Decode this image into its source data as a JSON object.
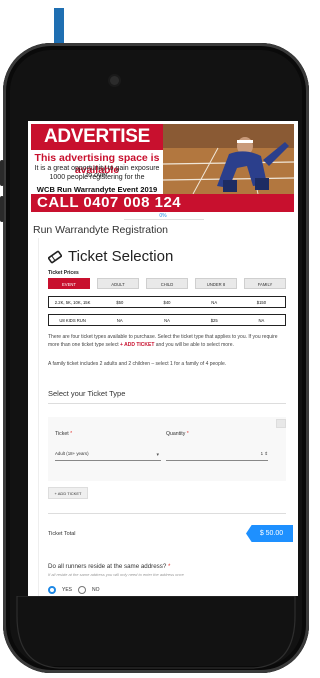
{
  "ad": {
    "title": "ADVERTISE HERE",
    "subtitle": "This advertising space is available",
    "line1": "It is a great opportunity to gain exposure to over",
    "line2": "1000 people registering for the",
    "event": "WCB Run Warrandyte Event 2019",
    "call": "CALL 0407 008 124"
  },
  "progress": {
    "label": "0%",
    "value": 0
  },
  "form_title": "Run Warrandyte Registration",
  "section": {
    "title": "Ticket Selection",
    "prices_label": "Ticket Prices"
  },
  "price_tabs": [
    "EVENT",
    "ADULT",
    "CHILD",
    "UNDER 8",
    "FAMILY"
  ],
  "price_rows": [
    [
      "2.2K, 5K, 10K, 15K",
      "$50",
      "$40",
      "NA",
      "$150"
    ],
    [
      "U8 KIDS RUN",
      "NA",
      "NA",
      "$25",
      "NA"
    ]
  ],
  "info": {
    "p1_a": "There are four ticket types available to purchase. Select the ticket type that applies to you. If you require more than one ticket type select ",
    "p1_red": "+ ADD TICKET",
    "p1_b": " and you will be able to select more.",
    "p2": "A family ticket includes 2 adults and 2 children – select 1 for a family of 4 people."
  },
  "select_label": "Select your Ticket Type",
  "ticket_field": {
    "label": "Ticket",
    "required": "*",
    "value": "Adult (18+ years)"
  },
  "quantity_field": {
    "label": "Quantity",
    "required": "*",
    "value": "1"
  },
  "add_ticket": "+ ADD TICKET",
  "total": {
    "label": "Ticket Total",
    "value": "$ 50.00"
  },
  "question": {
    "label": "Do all runners reside at the same address?",
    "required": "*",
    "hint": "If all reside at the same address you will only need to enter the address once",
    "options": [
      "YES",
      "NO"
    ]
  },
  "colors": {
    "brand_red": "#c8102e",
    "accent_blue": "#1e90ff",
    "arrow_blue": "#1f6fb2"
  }
}
